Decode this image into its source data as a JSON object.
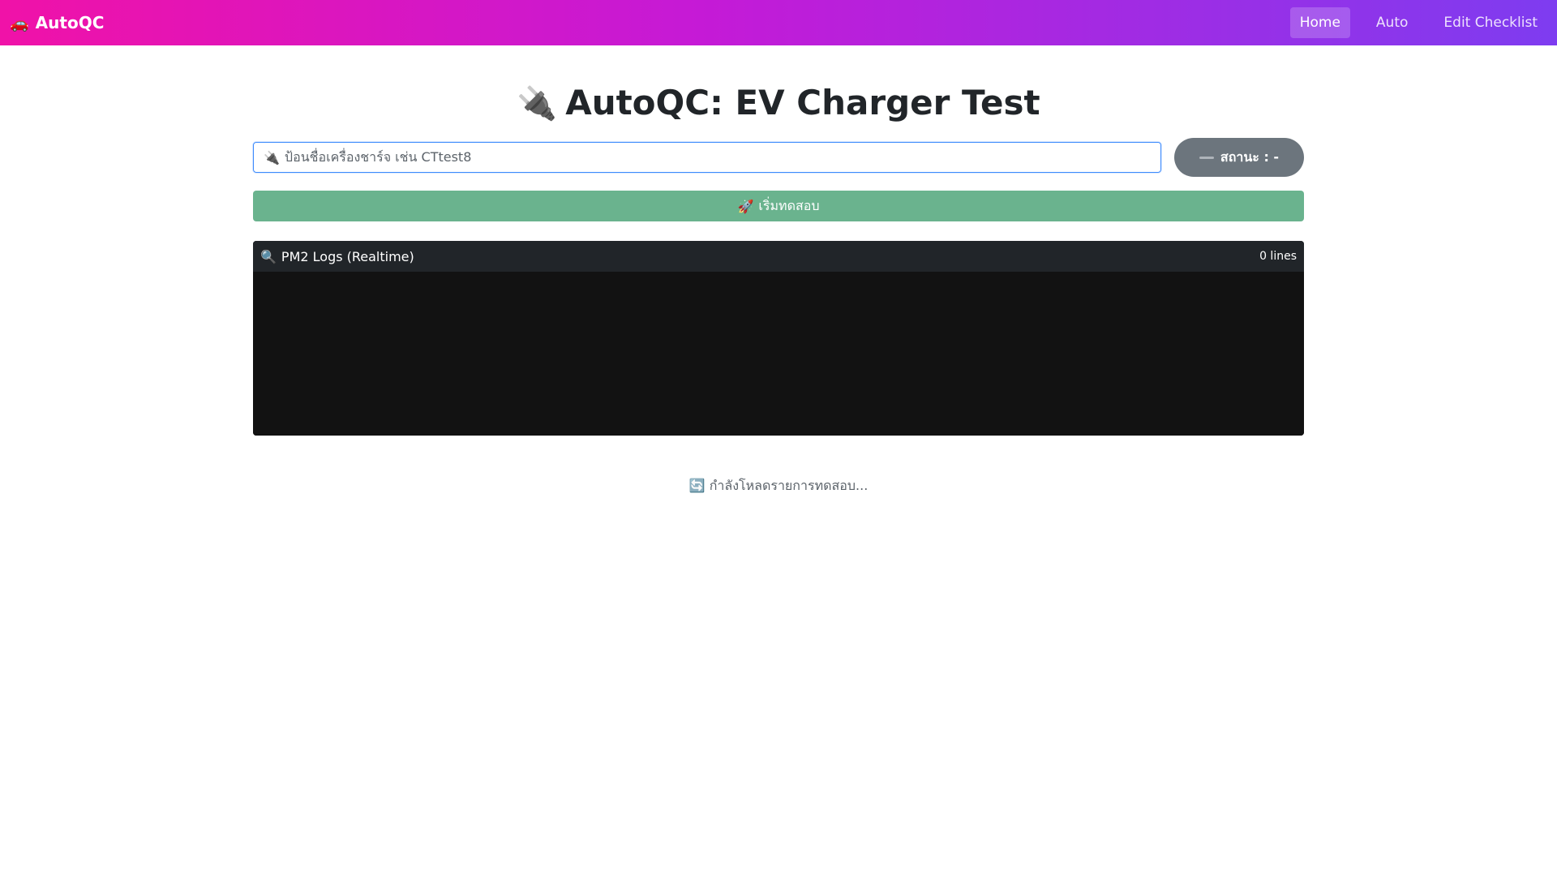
{
  "navbar": {
    "brand_icon": "car-icon",
    "brand_emoji": "🚗",
    "brand": "AutoQC",
    "links": [
      {
        "label": "Home",
        "active": true
      },
      {
        "label": "Auto",
        "active": false
      },
      {
        "label": "Edit Checklist",
        "active": false
      }
    ],
    "gradient": [
      "#f012a8",
      "#c51ad6",
      "#7e3cf0"
    ]
  },
  "main": {
    "title_icon": "plug-icon",
    "title_emoji": "🔌",
    "title": "AutoQC: EV Charger Test",
    "charger_input": {
      "icon": "plug-icon",
      "icon_emoji": "🔌",
      "placeholder": "ป้อนชื่อเครื่องชาร์จ เช่น CTtest8",
      "value": ""
    },
    "status": {
      "icon": "dash-icon",
      "label": "สถานะ : -",
      "color": "#6c757d"
    },
    "start_button": {
      "icon": "rocket-icon",
      "icon_emoji": "🚀",
      "label": "เริ่มทดสอบ",
      "color": "#6ab38e"
    },
    "logs": {
      "icon": "search-icon",
      "icon_emoji": "🔍",
      "title": "PM2 Logs (Realtime)",
      "count": "0 lines",
      "lines": []
    },
    "loading": {
      "icon": "refresh-icon",
      "icon_emoji": "🔄",
      "text": "กำลังโหลดรายการทดสอบ..."
    }
  }
}
